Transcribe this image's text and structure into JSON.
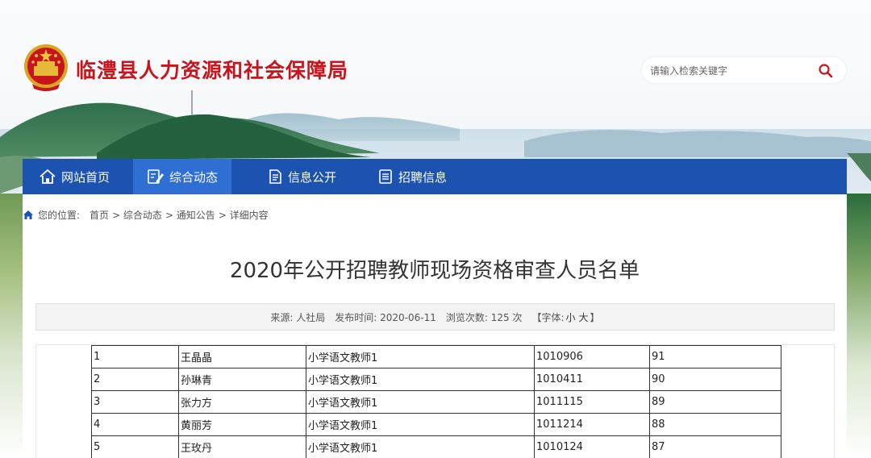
{
  "header": {
    "site_title": "临澧县人力资源和社会保障局",
    "search_placeholder": "请输入检索关键字"
  },
  "nav": {
    "items": [
      {
        "label": "网站首页",
        "icon": "home-icon"
      },
      {
        "label": "综合动态",
        "icon": "edit-icon"
      },
      {
        "label": "信息公开",
        "icon": "document-icon"
      },
      {
        "label": "招聘信息",
        "icon": "list-icon"
      }
    ]
  },
  "breadcrumb": {
    "prefix": "您的位置:",
    "items": [
      "首页",
      "> 综合动态",
      "> 通知公告",
      "> 详细内容"
    ]
  },
  "article": {
    "title": "2020年公开招聘教师现场资格审查人员名单",
    "meta": {
      "source": "来源:  人社局",
      "date": "发布时间:  2020-06-11",
      "views": "浏览次数:   125  次",
      "font_prefix": "【字体:",
      "font_small": "小",
      "font_large": "大",
      "font_suffix": "】"
    }
  },
  "table": {
    "rows": [
      [
        "1",
        "王晶晶",
        "小学语文教师1",
        "1010906",
        "91"
      ],
      [
        "2",
        "孙琳青",
        "小学语文教师1",
        "1010411",
        "90"
      ],
      [
        "3",
        "张力方",
        "小学语文教师1",
        "1011115",
        "89"
      ],
      [
        "4",
        "黄丽芳",
        "小学语文教师1",
        "1011214",
        "88"
      ],
      [
        "5",
        "王玫丹",
        "小学语文教师1",
        "1010124",
        "87"
      ]
    ]
  },
  "colors": {
    "nav_bg": "#1c53b1",
    "nav_active": "#2f6fd4",
    "title_red": "#c8141c"
  }
}
